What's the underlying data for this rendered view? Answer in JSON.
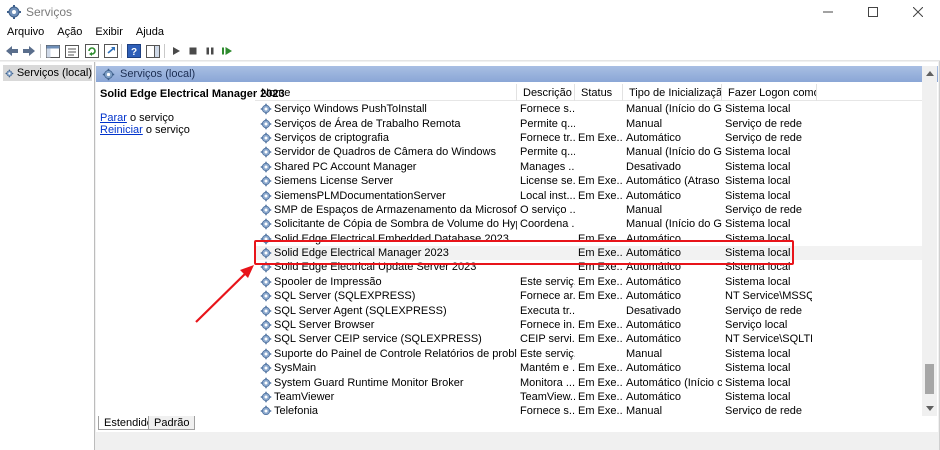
{
  "window": {
    "title": "Serviços"
  },
  "menu": [
    "Arquivo",
    "Ação",
    "Exibir",
    "Ajuda"
  ],
  "tree": {
    "root": "Serviços (local)"
  },
  "pane": {
    "header": "Serviços (local)"
  },
  "detail": {
    "service_name": "Solid Edge Electrical Manager 2023",
    "stop_link": "Parar",
    "stop_suffix": " o serviço",
    "restart_link": "Reiniciar",
    "restart_suffix": " o serviço"
  },
  "columns": [
    "Nome",
    "Descrição",
    "Status",
    "Tipo de Inicialização",
    "Fazer Logon como"
  ],
  "rows": [
    {
      "name": "Serviço Windows PushToInstall",
      "desc": "Fornece s...",
      "status": "",
      "start": "Manual (Início do Ga...",
      "logon": "Sistema local"
    },
    {
      "name": "Serviços de Área de Trabalho Remota",
      "desc": "Permite q...",
      "status": "",
      "start": "Manual",
      "logon": "Serviço de rede"
    },
    {
      "name": "Serviços de criptografia",
      "desc": "Fornece tr...",
      "status": "Em Exe...",
      "start": "Automático",
      "logon": "Serviço de rede"
    },
    {
      "name": "Servidor de Quadros de Câmera do Windows",
      "desc": "Permite q...",
      "status": "",
      "start": "Manual (Início do Ga...",
      "logon": "Sistema local"
    },
    {
      "name": "Shared PC Account Manager",
      "desc": "Manages ...",
      "status": "",
      "start": "Desativado",
      "logon": "Sistema local"
    },
    {
      "name": "Siemens License Server",
      "desc": "License se...",
      "status": "Em Exe...",
      "start": "Automático (Atraso ...",
      "logon": "Sistema local"
    },
    {
      "name": "SiemensPLMDocumentationServer",
      "desc": "Local inst...",
      "status": "Em Exe...",
      "start": "Automático",
      "logon": "Sistema local"
    },
    {
      "name": "SMP de Espaços de Armazenamento da Microsoft",
      "desc": "O serviço ...",
      "status": "",
      "start": "Manual",
      "logon": "Serviço de rede"
    },
    {
      "name": "Solicitante de Cópia de Sombra de Volume do Hyper-V",
      "desc": "Coordena ...",
      "status": "",
      "start": "Manual (Início do Ga...",
      "logon": "Sistema local"
    },
    {
      "name": "Solid Edge Electrical Embedded Database 2023",
      "desc": "",
      "status": "Em Exe...",
      "start": "Automático",
      "logon": "Sistema local"
    },
    {
      "name": "Solid Edge Electrical Manager 2023",
      "desc": "",
      "status": "Em Exe...",
      "start": "Automático",
      "logon": "Sistema local"
    },
    {
      "name": "Solid Edge Electrical Update Server 2023",
      "desc": "",
      "status": "Em Exe...",
      "start": "Automático",
      "logon": "Sistema local"
    },
    {
      "name": "Spooler de Impressão",
      "desc": "Este serviç...",
      "status": "Em Exe...",
      "start": "Automático",
      "logon": "Sistema local"
    },
    {
      "name": "SQL Server (SQLEXPRESS)",
      "desc": "Fornece ar...",
      "status": "Em Exe...",
      "start": "Automático",
      "logon": "NT Service\\MSSQL..."
    },
    {
      "name": "SQL Server Agent (SQLEXPRESS)",
      "desc": "Executa tr...",
      "status": "",
      "start": "Desativado",
      "logon": "Serviço de rede"
    },
    {
      "name": "SQL Server Browser",
      "desc": "Fornece in...",
      "status": "Em Exe...",
      "start": "Automático",
      "logon": "Serviço local"
    },
    {
      "name": "SQL Server CEIP service (SQLEXPRESS)",
      "desc": "CEIP servi...",
      "status": "Em Exe...",
      "start": "Automático",
      "logon": "NT Service\\SQLTEL..."
    },
    {
      "name": "Suporte do Painel de Controle Relatórios de problemas",
      "desc": "Este serviç...",
      "status": "",
      "start": "Manual",
      "logon": "Sistema local"
    },
    {
      "name": "SysMain",
      "desc": "Mantém e ...",
      "status": "Em Exe...",
      "start": "Automático",
      "logon": "Sistema local"
    },
    {
      "name": "System Guard Runtime Monitor Broker",
      "desc": "Monitora ...",
      "status": "Em Exe...",
      "start": "Automático (Início c...",
      "logon": "Sistema local"
    },
    {
      "name": "TeamViewer",
      "desc": "TeamView...",
      "status": "Em Exe...",
      "start": "Automático",
      "logon": "Sistema local"
    },
    {
      "name": "Telefonia",
      "desc": "Fornece s...",
      "status": "Em Exe...",
      "start": "Manual",
      "logon": "Serviço de rede"
    }
  ],
  "tabs": [
    "Estendido",
    "Padrão"
  ],
  "icons": {
    "app": "gear-icon",
    "back": "back-arrow-icon",
    "forward": "forward-arrow-icon",
    "play": "play-icon",
    "stop": "stop-icon",
    "pause": "pause-icon",
    "restart": "restart-icon"
  },
  "colors": {
    "highlight": "#e8141a",
    "header_bar": "#8faadc",
    "link": "#0033cc"
  }
}
